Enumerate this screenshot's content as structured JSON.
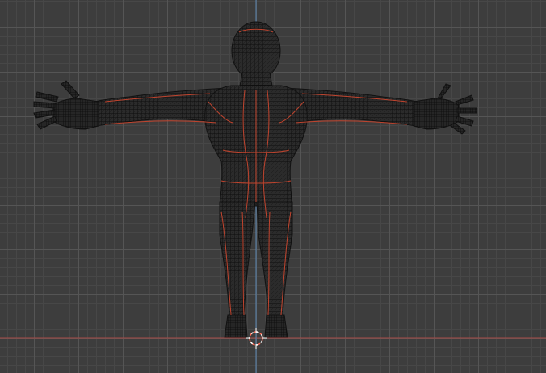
{
  "viewport": {
    "view": "front-orthographic",
    "mode": "edit",
    "display": "wireframe",
    "grid_visible": true,
    "x_axis_visible": true,
    "z_axis_visible": true,
    "3d_cursor_visible": true
  },
  "colors": {
    "background": "#3d3d3d",
    "grid_minor": "#474747",
    "grid_major": "#555555",
    "x_axis": "#a84a48",
    "z_axis": "#5b86b4",
    "mesh_fill": "#2a2a2a",
    "mesh_wire": "#000000",
    "selected_edges": "#c0442e",
    "cursor_red": "#ff6a55",
    "cursor_white": "#ffffff"
  },
  "object": {
    "type": "humanoid-mesh",
    "pose": "t-pose"
  }
}
